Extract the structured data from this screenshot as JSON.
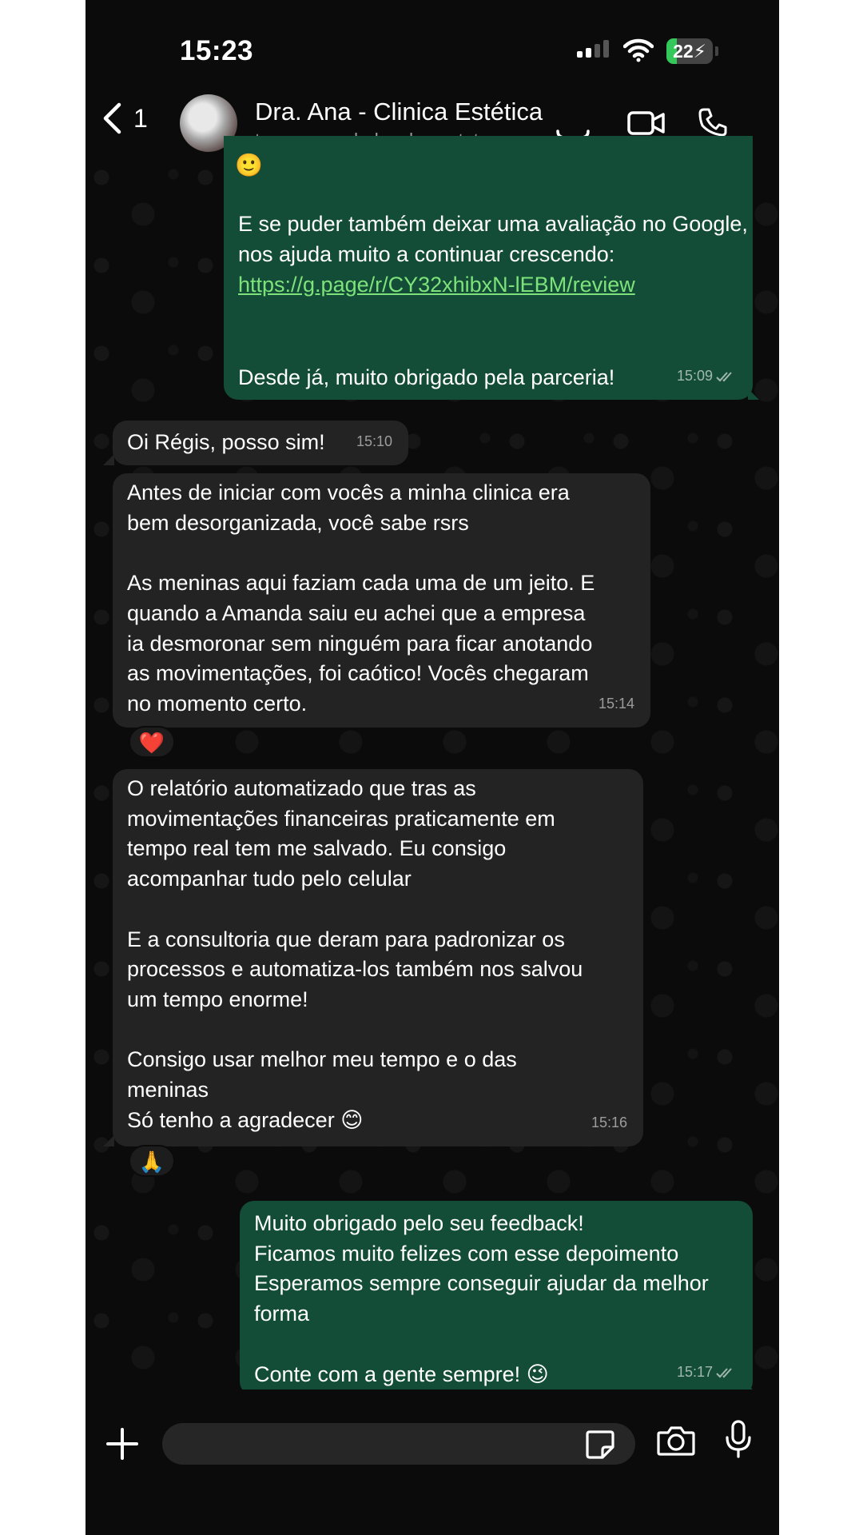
{
  "status_bar": {
    "time": "15:23",
    "battery": "22",
    "battery_level": 0.22
  },
  "header": {
    "back_count": "1",
    "contact_name": "Dra. Ana - Clinica Estética",
    "contact_subtitle": "toque para dados do contato"
  },
  "messages": [
    {
      "direction": "out",
      "emoji": "🙂",
      "text_before_link": "E se puder também deixar uma avaliação no Google, nos ajuda muito a continuar crescendo:",
      "link": "https://g.page/r/CY32xhibxN-lEBM/review",
      "text_after_link": "Desde já, muito obrigado pela parceria!",
      "time": "15:09"
    },
    {
      "direction": "in",
      "text": "Oi Régis, posso sim!",
      "time": "15:10"
    },
    {
      "direction": "in",
      "text": "Antes de iniciar com vocês a minha clinica era\nbem desorganizada, você sabe rsrs\n\nAs meninas aqui faziam cada uma de um jeito. E\nquando a Amanda saiu eu achei que a empresa\nia desmoronar sem ninguém para ficar anotando\nas movimentações, foi caótico!  Vocês chegaram\nno momento certo.",
      "time": "15:14",
      "reaction": "❤️"
    },
    {
      "direction": "in",
      "text": "O relatório automatizado que tras as\nmovimentações financeiras praticamente em\ntempo real tem me salvado. Eu consigo\nacompanhar tudo pelo celular\n\nE a consultoria que deram para padronizar os\nprocessos e automatiza-los também nos salvou\num tempo enorme!\n\nConsigo usar melhor meu tempo e o das\nmeninas\nSó tenho a agradecer 😊",
      "time": "15:16",
      "reaction": "🙏"
    },
    {
      "direction": "out",
      "text": "Muito obrigado pelo seu feedback!\nFicamos muito felizes com esse depoimento\nEsperamos sempre conseguir ajudar da melhor\nforma\n\nConte com a gente sempre! 😉",
      "time": "15:17"
    }
  ],
  "input": {
    "value": ""
  }
}
